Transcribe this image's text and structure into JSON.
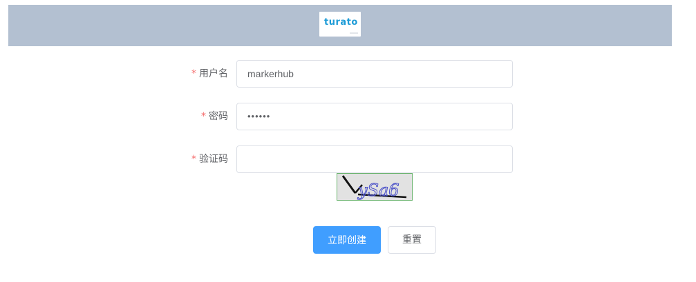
{
  "header": {
    "logo_text": "turato"
  },
  "form": {
    "username": {
      "required_mark": "*",
      "label": "用户名",
      "value": "markerhub"
    },
    "password": {
      "required_mark": "*",
      "label": "密码",
      "value": "••••••"
    },
    "captcha": {
      "required_mark": "*",
      "label": "验证码",
      "value": "",
      "image_text": "ySa6"
    }
  },
  "buttons": {
    "submit_label": "立即创建",
    "reset_label": "重置"
  },
  "colors": {
    "header_bg": "#b3c0d1",
    "primary": "#409eff",
    "required": "#f56c6c",
    "logo": "#1e9cd7"
  }
}
